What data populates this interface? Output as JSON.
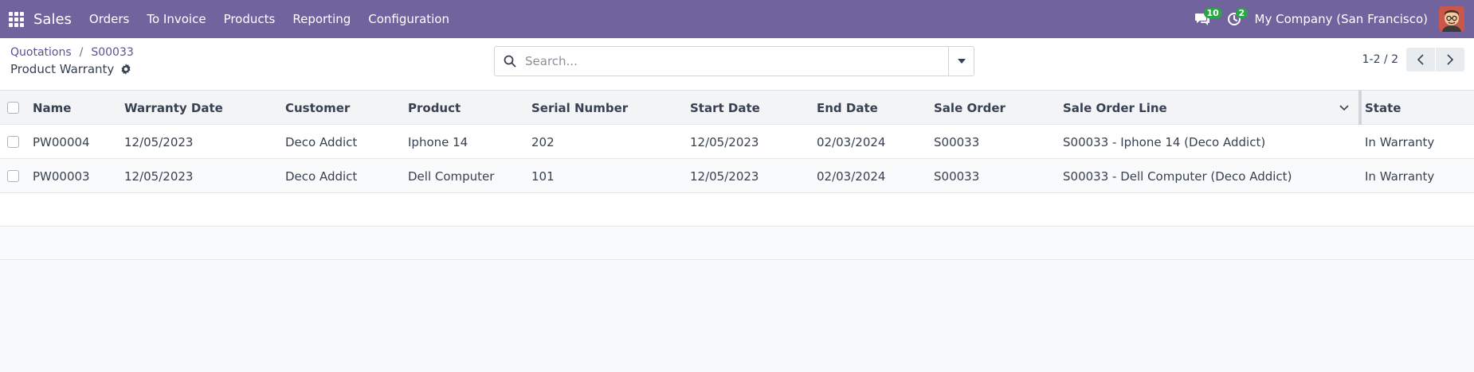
{
  "navbar": {
    "app_name": "Sales",
    "menu": [
      "Orders",
      "To Invoice",
      "Products",
      "Reporting",
      "Configuration"
    ],
    "messages_count": "10",
    "activities_count": "2",
    "company": "My Company (San Francisco)",
    "bg_color": "#71639e"
  },
  "breadcrumb": {
    "items": [
      "Quotations",
      "S00033"
    ],
    "separator": "/",
    "current": "Product Warranty"
  },
  "search": {
    "placeholder": "Search..."
  },
  "pager": {
    "value": "1-2 / 2"
  },
  "table": {
    "columns": [
      "Name",
      "Warranty Date",
      "Customer",
      "Product",
      "Serial Number",
      "Start Date",
      "End Date",
      "Sale Order",
      "Sale Order Line",
      "State"
    ],
    "rows": [
      [
        "PW00004",
        "12/05/2023",
        "Deco Addict",
        "Iphone 14",
        "202",
        "12/05/2023",
        "02/03/2024",
        "S00033",
        "S00033 - Iphone 14 (Deco Addict)",
        "In Warranty"
      ],
      [
        "PW00003",
        "12/05/2023",
        "Deco Addict",
        "Dell Computer",
        "101",
        "12/05/2023",
        "02/03/2024",
        "S00033",
        "S00033 - Dell Computer (Deco Addict)",
        "In Warranty"
      ]
    ]
  },
  "icons": {
    "apps": "apps-grid-icon",
    "messages": "chat-bubble-icon",
    "activities": "clock-icon",
    "settings": "gear-icon",
    "search": "search-icon",
    "toggle": "caret-down-icon",
    "prev": "chevron-left-icon",
    "next": "chevron-right-icon",
    "sort": "chevron-down-icon"
  }
}
